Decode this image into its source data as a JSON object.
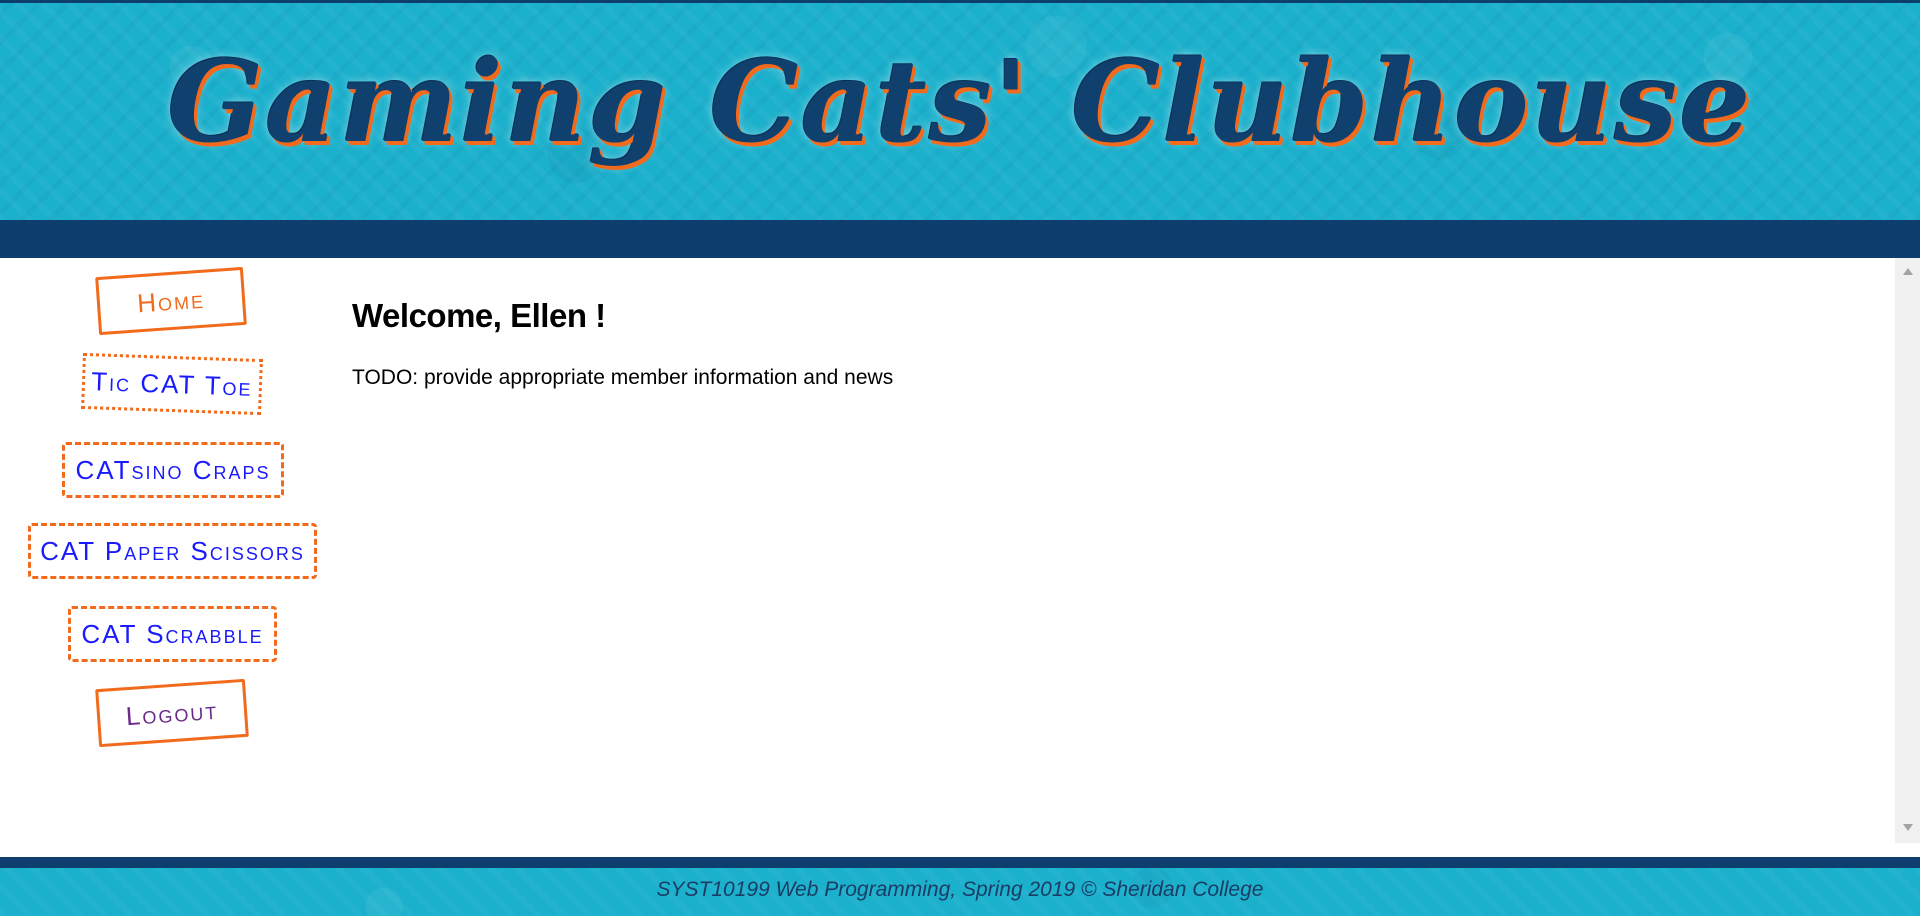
{
  "header": {
    "title": "Gaming Cats' Clubhouse"
  },
  "nav": {
    "items": [
      {
        "label": "Home"
      },
      {
        "label": "Tic CAT Toe"
      },
      {
        "label": "CATsino Craps"
      },
      {
        "label": "CAT Paper Scissors"
      },
      {
        "label": "CAT Scrabble"
      },
      {
        "label": "Logout"
      }
    ]
  },
  "main": {
    "welcome": "Welcome, Ellen !",
    "todo": "TODO: provide appropriate member information and news"
  },
  "footer": {
    "text": "SYST10199 Web Programming, Spring 2019 © Sheridan College"
  },
  "colors": {
    "banner": "#1bb0cc",
    "navy": "#0d3e6e",
    "accent_orange": "#f26a1b",
    "link_blue": "#1a1aff"
  }
}
